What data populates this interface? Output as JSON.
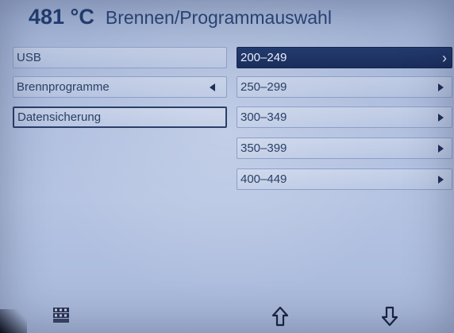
{
  "header": {
    "temperature": "481 °C",
    "title": "Brennen/Programmauswahl"
  },
  "left_menu": {
    "items": [
      {
        "label": "USB"
      },
      {
        "label": "Brennprogramme"
      },
      {
        "label": "Datensicherung"
      }
    ]
  },
  "right_menu": {
    "items": [
      {
        "label": "200–249"
      },
      {
        "label": "250–299"
      },
      {
        "label": "300–349"
      },
      {
        "label": "350–399"
      },
      {
        "label": "400–449"
      }
    ],
    "selected_index": 0
  },
  "footer": {
    "icons": [
      "numeric-keypad-icon",
      "arrow-up-icon",
      "arrow-down-icon"
    ]
  },
  "colors": {
    "screen_bg": "#b0bfdf",
    "text": "#2a3f66",
    "selected_bg": "#1a2e5c",
    "header_text": "#233f72"
  }
}
